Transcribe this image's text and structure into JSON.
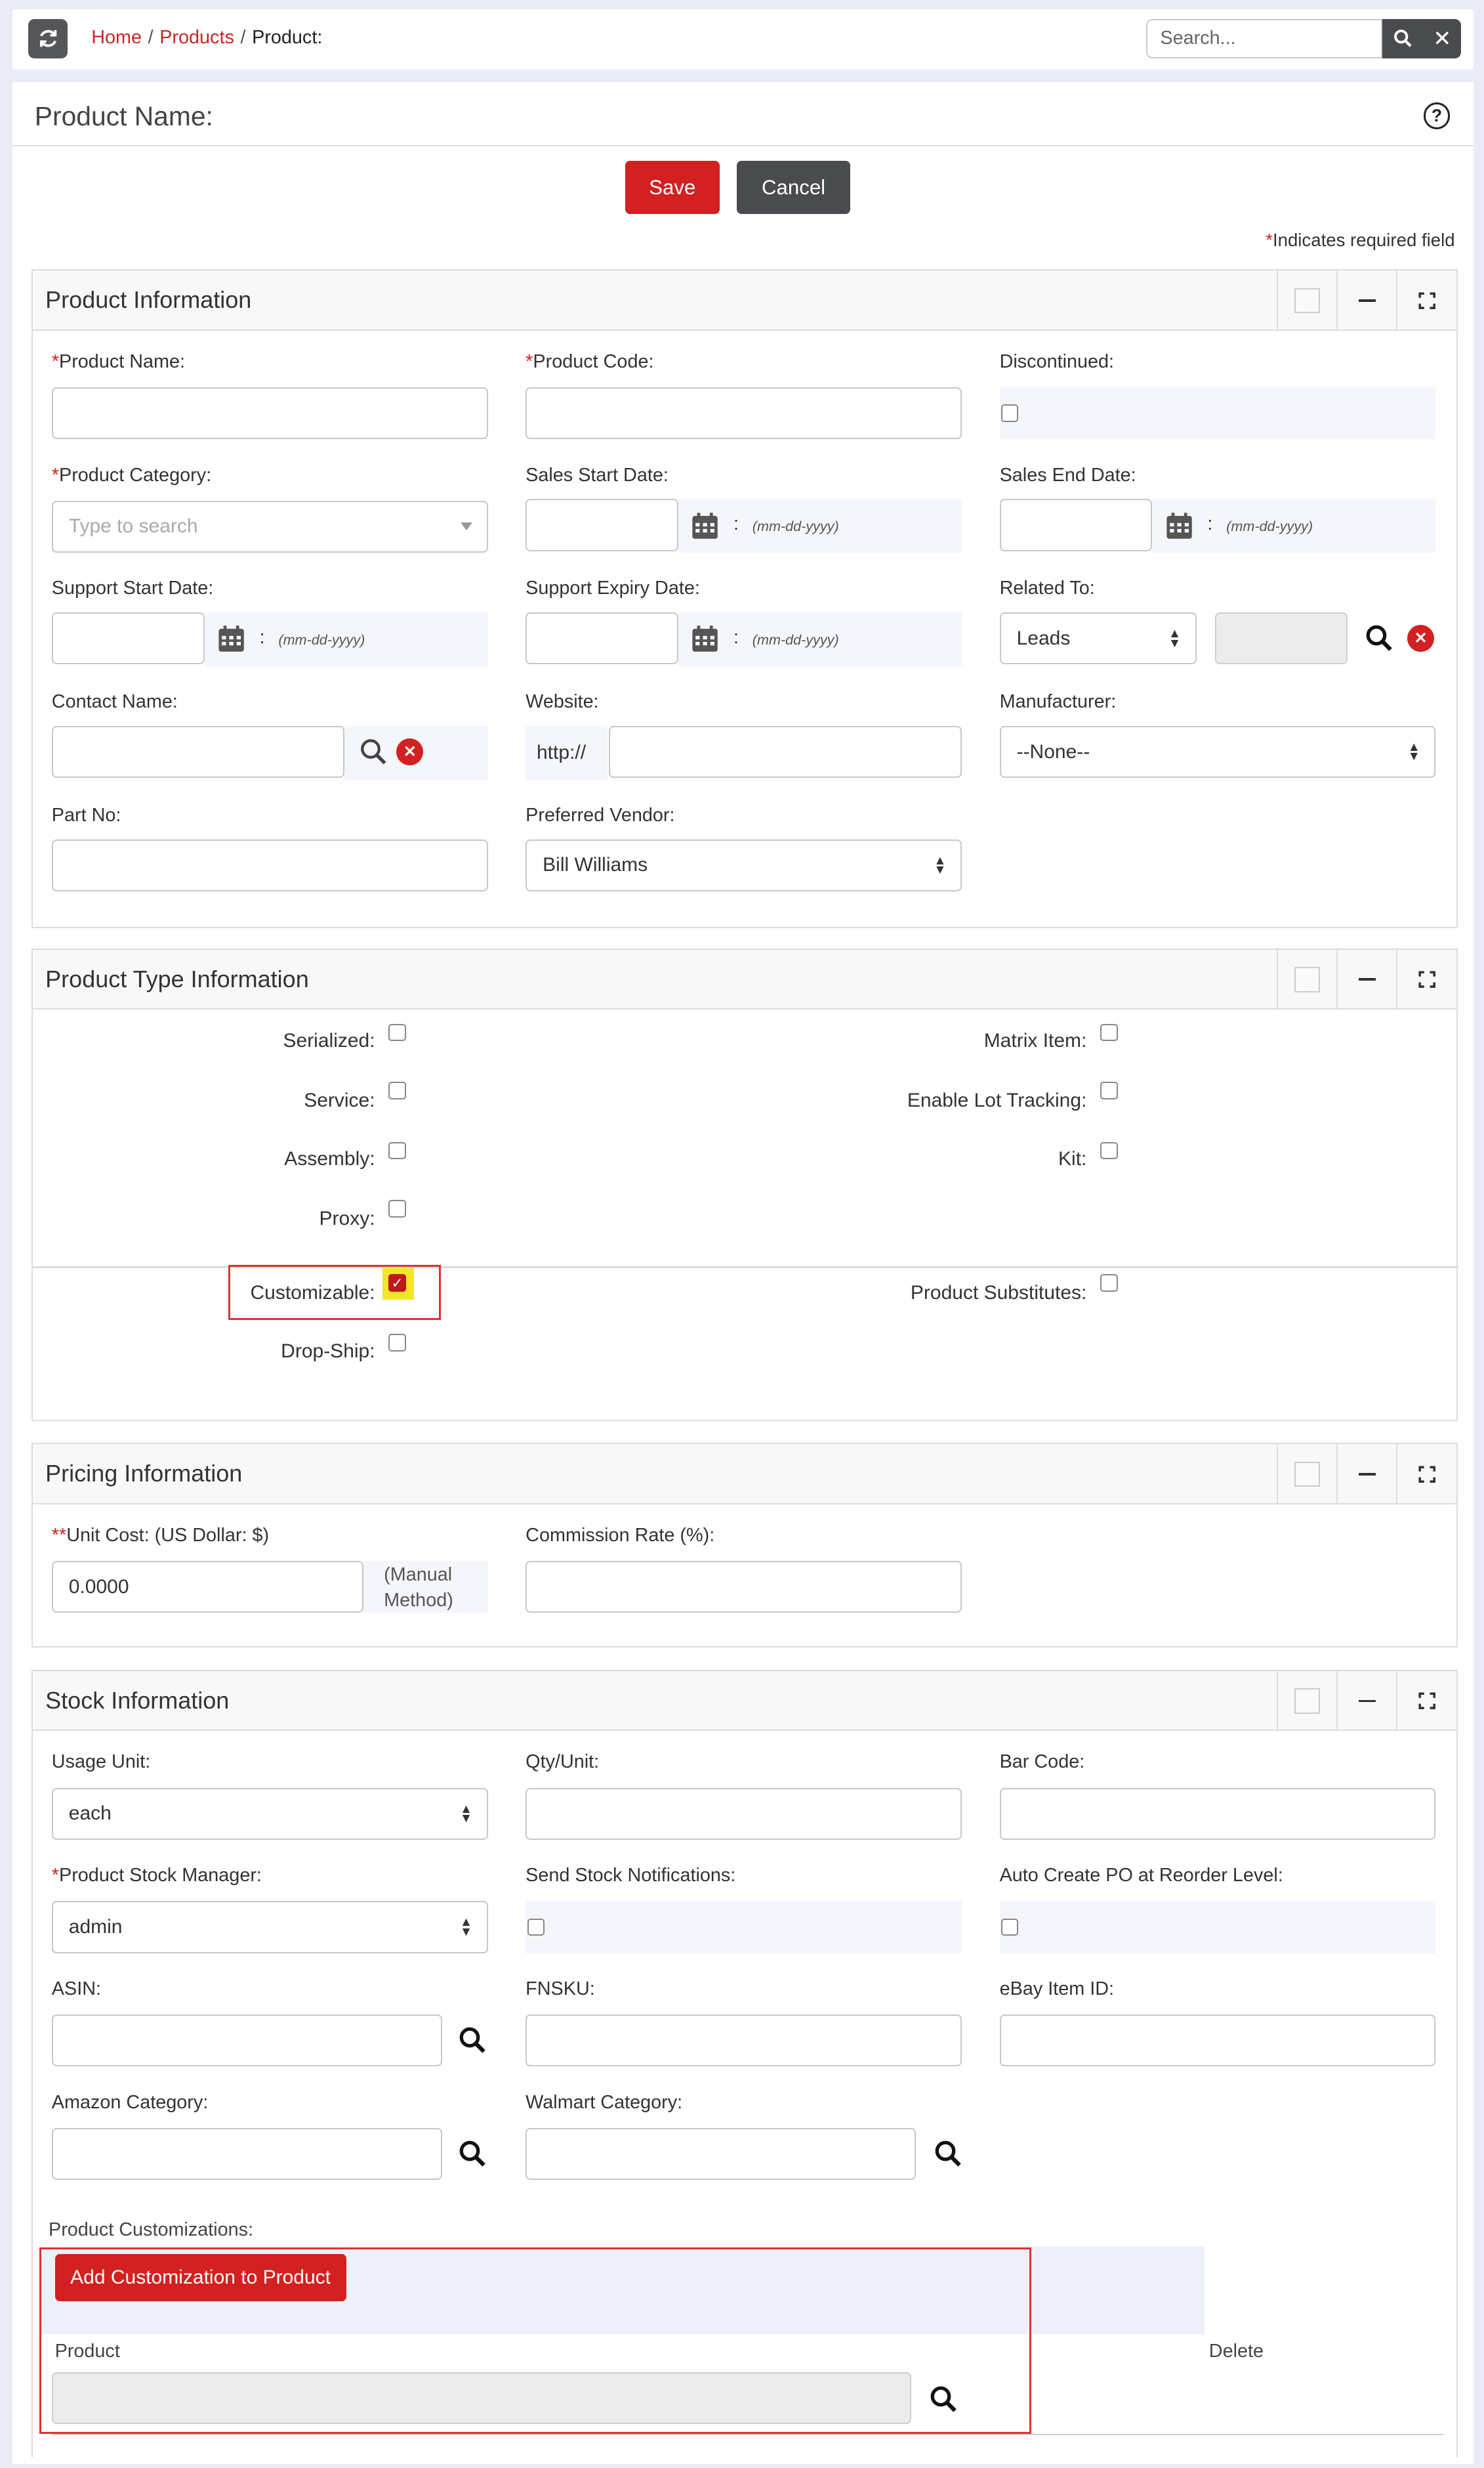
{
  "topbar": {
    "breadcrumb": {
      "home": "Home",
      "products": "Products",
      "current": "Product:"
    },
    "search_placeholder": "Search..."
  },
  "page": {
    "title": "Product Name:",
    "save_label": "Save",
    "cancel_label": "Cancel",
    "required_note": "Indicates required field"
  },
  "product_info": {
    "title": "Product Information",
    "product_name_label": "Product Name:",
    "product_code_label": "Product Code:",
    "discontinued_label": "Discontinued:",
    "product_category_label": "Product Category:",
    "product_category_placeholder": "Type to search",
    "sales_start_label": "Sales Start Date:",
    "sales_end_label": "Sales End Date:",
    "support_start_label": "Support Start Date:",
    "support_expiry_label": "Support Expiry Date:",
    "related_to_label": "Related To:",
    "related_to_value": "Leads",
    "contact_name_label": "Contact Name:",
    "website_label": "Website:",
    "website_prefix": "http://",
    "manufacturer_label": "Manufacturer:",
    "manufacturer_value": "--None--",
    "part_no_label": "Part No:",
    "preferred_vendor_label": "Preferred Vendor:",
    "preferred_vendor_value": "Bill Williams",
    "date_format": "(mm-dd-yyyy)",
    "colon": ":"
  },
  "product_type": {
    "title": "Product Type Information",
    "serialized": "Serialized:",
    "matrix_item": "Matrix Item:",
    "service": "Service:",
    "enable_lot_tracking": "Enable Lot Tracking:",
    "assembly": "Assembly:",
    "kit": "Kit:",
    "proxy": "Proxy:",
    "customizable": "Customizable:",
    "customizable_checked": true,
    "product_substitutes": "Product Substitutes:",
    "drop_ship": "Drop-Ship:"
  },
  "pricing": {
    "title": "Pricing Information",
    "unit_cost_label": "Unit Cost:",
    "unit_cost_currency": "(US Dollar: $)",
    "unit_cost_value": "0.0000",
    "manual_method_1": "(Manual",
    "manual_method_2": "Method)",
    "commission_label": "Commission Rate (%):"
  },
  "stock": {
    "title": "Stock Information",
    "usage_unit_label": "Usage Unit:",
    "usage_unit_value": "each",
    "qty_unit_label": "Qty/Unit:",
    "bar_code_label": "Bar Code:",
    "stock_manager_label": "Product Stock Manager:",
    "stock_manager_value": "admin",
    "send_notifications_label": "Send Stock Notifications:",
    "auto_po_label": "Auto Create PO at Reorder Level:",
    "asin_label": "ASIN:",
    "fnsku_label": "FNSKU:",
    "ebay_label": "eBay Item ID:",
    "amazon_category_label": "Amazon Category:",
    "walmart_category_label": "Walmart Category:",
    "customizations_label": "Product Customizations:",
    "add_customization_label": "Add Customization to Product",
    "col_product": "Product",
    "col_delete": "Delete"
  },
  "colors": {
    "accent_red": "#d32020",
    "dark_button": "#4a4b4f",
    "highlight": "#f5e62a"
  }
}
